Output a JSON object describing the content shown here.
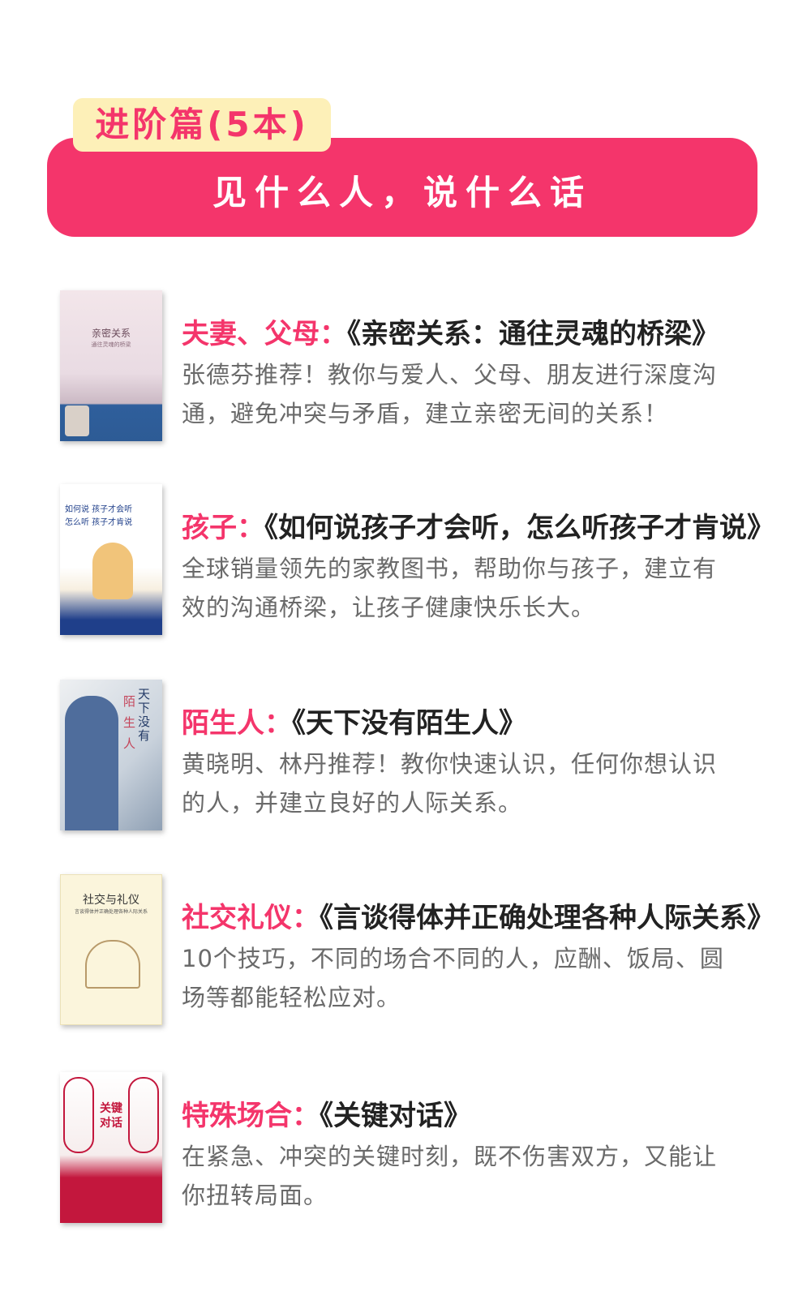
{
  "section": {
    "tag": "进阶篇(5本)",
    "title": "见什么人，说什么话"
  },
  "books": [
    {
      "who": "夫妻、父母：",
      "title": "《亲密关系：通往灵魂的桥梁》",
      "desc": "张德芬推荐！教你与爱人、父母、朋友进行深度沟通，避免冲突与矛盾，建立亲密无间的关系！",
      "cover_title": "亲密关系",
      "cover_subtitle": "通往灵魂的桥梁"
    },
    {
      "who": "孩子：",
      "title": "《如何说孩子才会听，怎么听孩子才肯说》",
      "desc": "全球销量领先的家教图书，帮助你与孩子，建立有效的沟通桥梁，让孩子健康快乐长大。",
      "cover_title": "如何说 孩子才会听",
      "cover_subtitle": "怎么听 孩子才肯说"
    },
    {
      "who": "陌生人：",
      "title": "《天下没有陌生人》",
      "desc": "黄晓明、林丹推荐！教你快速认识，任何你想认识的人，并建立良好的人际关系。",
      "cover_title": "天下没有",
      "cover_subtitle": "陌生人"
    },
    {
      "who": "社交礼仪：",
      "title": "《言谈得体并正确处理各种人际关系》",
      "desc": "10个技巧，不同的场合不同的人，应酬、饭局、圆场等都能轻松应对。",
      "cover_title": "社交与礼仪",
      "cover_subtitle": "言谈得体并正确处理各种人际关系"
    },
    {
      "who": "特殊场合：",
      "title": "《关键对话》",
      "desc": "在紧急、冲突的关键时刻，既不伤害双方，又能让你扭转局面。",
      "cover_title": "关键",
      "cover_subtitle": "对话"
    }
  ],
  "colors": {
    "accent": "#f4356b",
    "tag_bg": "#fdf0b8",
    "desc_text": "#6a6a6a"
  }
}
